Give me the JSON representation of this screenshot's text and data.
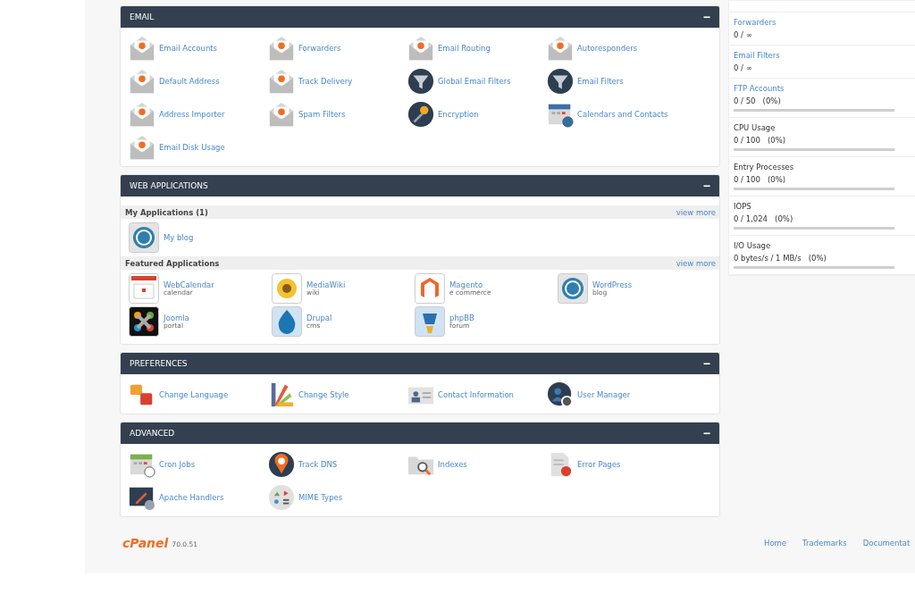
{
  "stats": [
    {
      "label": "Forwarders",
      "value": "0 / ∞",
      "kind": "link"
    },
    {
      "label": "Email Filters",
      "value": "0 / ∞",
      "kind": "link"
    },
    {
      "label": "FTP Accounts",
      "value": "0 / 50   (0%)",
      "kind": "link",
      "level": 0
    },
    {
      "label": "CPU Usage",
      "value": "0 / 100   (0%)",
      "kind": "text",
      "level": 0
    },
    {
      "label": "Entry Processes",
      "value": "0 / 100   (0%)",
      "kind": "text",
      "level": 0
    },
    {
      "label": "IOPS",
      "value": "0 / 1,024   (0%)",
      "kind": "text",
      "level": 0
    },
    {
      "label": "I/O Usage",
      "value": "0 bytes/s / 1 MB/s   (0%)",
      "kind": "text",
      "level": 0
    }
  ],
  "sections": [
    {
      "title": "EMAIL",
      "kind": "tools",
      "collapse": "−",
      "items": [
        "Email Accounts",
        "Forwarders",
        "Email Routing",
        "Autoresponders",
        "Default Address",
        "Track Delivery",
        "Global Email Filters",
        "Email Filters",
        "Address Importer",
        "Spam Filters",
        "Encryption",
        "Calendars and Contacts",
        "Email Disk Usage"
      ]
    },
    {
      "title": "WEB APPLICATIONS",
      "kind": "apps",
      "collapse": "−",
      "groups": [
        {
          "title": "My Applications (1)",
          "more": "view more",
          "apps": [
            {
              "name": "My blog"
            }
          ]
        },
        {
          "title": "Featured Applications",
          "more": "view more",
          "apps": [
            {
              "name": "WebCalendar",
              "sub": "calendar"
            },
            {
              "name": "MediaWiki",
              "sub": "wiki"
            },
            {
              "name": "Magento",
              "sub": "e commerce"
            },
            {
              "name": "WordPress",
              "sub": "blog"
            },
            {
              "name": "Joomla",
              "sub": "portal"
            },
            {
              "name": "Drupal",
              "sub": "cms"
            },
            {
              "name": "phpBB",
              "sub": "forum"
            }
          ]
        }
      ]
    },
    {
      "title": "PREFERENCES",
      "kind": "tools",
      "collapse": "−",
      "items": [
        "Change Language",
        "Change Style",
        "Contact Information",
        "User Manager"
      ]
    },
    {
      "title": "ADVANCED",
      "kind": "tools",
      "collapse": "−",
      "items": [
        "Cron Jobs",
        "Track DNS",
        "Indexes",
        "Error Pages",
        "Apache Handlers",
        "MIME Types"
      ]
    }
  ],
  "footer": {
    "logo": "cPanel",
    "version": "70.0.51",
    "links": [
      "Home",
      "Trademarks",
      "Documentat"
    ]
  }
}
